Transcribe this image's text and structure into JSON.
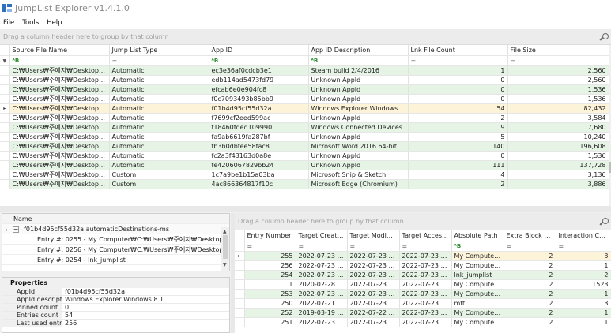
{
  "window": {
    "title": "JumpList Explorer v1.4.1.0"
  },
  "menu": [
    "File",
    "Tools",
    "Help"
  ],
  "top_grid": {
    "group_hint": "Drag a column header here to group by that column",
    "columns": [
      "Source File Name",
      "Jump List Type",
      "App ID",
      "App ID Description",
      "Lnk File Count",
      "File Size"
    ],
    "filter_symbols": [
      "ᴬB",
      "=",
      "ᴬB",
      "ᴬB",
      "=",
      "="
    ],
    "rows": [
      [
        "C:₩Users₩주예지₩Desktop₩Ink...",
        "Automatic",
        "ec3e36af0cdcb3e1",
        "Steam build 2/4/2016",
        "1",
        "2,560"
      ],
      [
        "C:₩Users₩주예지₩Desktop₩Ink...",
        "Automatic",
        "edb114ad5473fd79",
        "Unknown AppId",
        "0",
        "2,560"
      ],
      [
        "C:₩Users₩주예지₩Desktop₩Ink...",
        "Automatic",
        "efcab6e0e904fc8",
        "Unknown AppId",
        "0",
        "1,536"
      ],
      [
        "C:₩Users₩주예지₩Desktop₩Ink...",
        "Automatic",
        "f0c7093493b85bb9",
        "Unknown AppId",
        "0",
        "1,536"
      ],
      [
        "C:₩Users₩주예지₩Desktop₩Ink...",
        "Automatic",
        "f01b4d95cf55d32a",
        "Windows Explorer Windows 8.1",
        "54",
        "82,432"
      ],
      [
        "C:₩Users₩주예지₩Desktop₩Ink...",
        "Automatic",
        "f7699cf2eed599ac",
        "Unknown AppId",
        "2",
        "3,584"
      ],
      [
        "C:₩Users₩주예지₩Desktop₩Ink...",
        "Automatic",
        "f18460fded109990",
        "Windows Connected Devices",
        "9",
        "7,680"
      ],
      [
        "C:₩Users₩주예지₩Desktop₩Ink...",
        "Automatic",
        "fa9ab6619fa287bf",
        "Unknown AppId",
        "5",
        "10,240"
      ],
      [
        "C:₩Users₩주예지₩Desktop₩Ink...",
        "Automatic",
        "fb3b0dbfee58fac8",
        "Microsoft Word 2016 64-bit",
        "140",
        "196,608"
      ],
      [
        "C:₩Users₩주예지₩Desktop₩Ink...",
        "Automatic",
        "fc2a3f43163d0a8e",
        "Unknown AppId",
        "0",
        "1,536"
      ],
      [
        "C:₩Users₩주예지₩Desktop₩Ink...",
        "Automatic",
        "fe4206067829bb24",
        "Unknown AppId",
        "111",
        "137,728"
      ],
      [
        "C:₩Users₩주예지₩Desktop₩Ink...",
        "Custom",
        "1c7a9be1b15a03ba",
        "Microsoft Snip & Sketch",
        "4",
        "3,136"
      ],
      [
        "C:₩Users₩주예지₩Desktop₩Ink...",
        "Custom",
        "4ac866364817f10c",
        "Microsoft Edge (Chromium)",
        "2",
        "3,886"
      ]
    ]
  },
  "tree": {
    "header": "Name",
    "root": "f01b4d95cf55d32a.automaticDestinations-ms",
    "children": [
      "Entry #: 0255 - My Computer₩C:₩Users₩주예지₩Desktop₩Ink...",
      "Entry #: 0256 - My Computer₩C:₩Users₩주예지₩Desktop₩In...",
      "Entry #: 0254 - lnk_jumplist"
    ]
  },
  "properties": {
    "title": "Properties",
    "rows": [
      [
        "AppId",
        "f01b4d95cf55d32a"
      ],
      [
        "AppId description",
        "Windows Explorer Windows 8.1"
      ],
      [
        "Pinned count",
        "0"
      ],
      [
        "Entries count",
        "54"
      ],
      [
        "Last used entry...",
        "256"
      ]
    ]
  },
  "entry_grid": {
    "group_hint": "Drag a column header here to group by that column",
    "columns": [
      "Entry Number",
      "Target Create...",
      "Target Modifie...",
      "Target Access...",
      "Absolute Path",
      "Extra Block Co...",
      "Interaction Count"
    ],
    "rows": [
      [
        "255",
        "2022-07-23 16...",
        "2022-07-23 16...",
        "2022-07-23 16...",
        "My Computer...",
        "2",
        "3"
      ],
      [
        "256",
        "2022-07-23 16...",
        "2022-07-23 16...",
        "2022-07-23 16...",
        "My Computer...",
        "2",
        "1"
      ],
      [
        "254",
        "2022-07-23 15...",
        "2022-07-23 16...",
        "2022-07-23 16...",
        "lnk_jumplist",
        "2",
        "2"
      ],
      [
        "1",
        "2020-02-28 08...",
        "2022-07-23 16...",
        "2022-07-23 15...",
        "My Computer...",
        "2",
        "1523"
      ],
      [
        "253",
        "2022-07-23 09...",
        "2022-07-23 09...",
        "2022-07-23 09...",
        "My Computer...",
        "2",
        "1"
      ],
      [
        "250",
        "2022-07-21 14...",
        "2022-07-23 09...",
        "2022-07-23 09...",
        "mft",
        "2",
        "3"
      ],
      [
        "252",
        "2019-03-19 04...",
        "2022-07-22 07...",
        "2022-07-23 07...",
        "My Computer...",
        "2",
        "1"
      ],
      [
        "251",
        "2022-07-23 08...",
        "2022-07-23 08...",
        "2022-07-23 08...",
        "My Computer...",
        "2",
        "1"
      ]
    ]
  },
  "colors": {
    "accent_green_row": "#e6f4e6",
    "selected_row": "#fdf3d8",
    "background": "#f0f0f0"
  }
}
